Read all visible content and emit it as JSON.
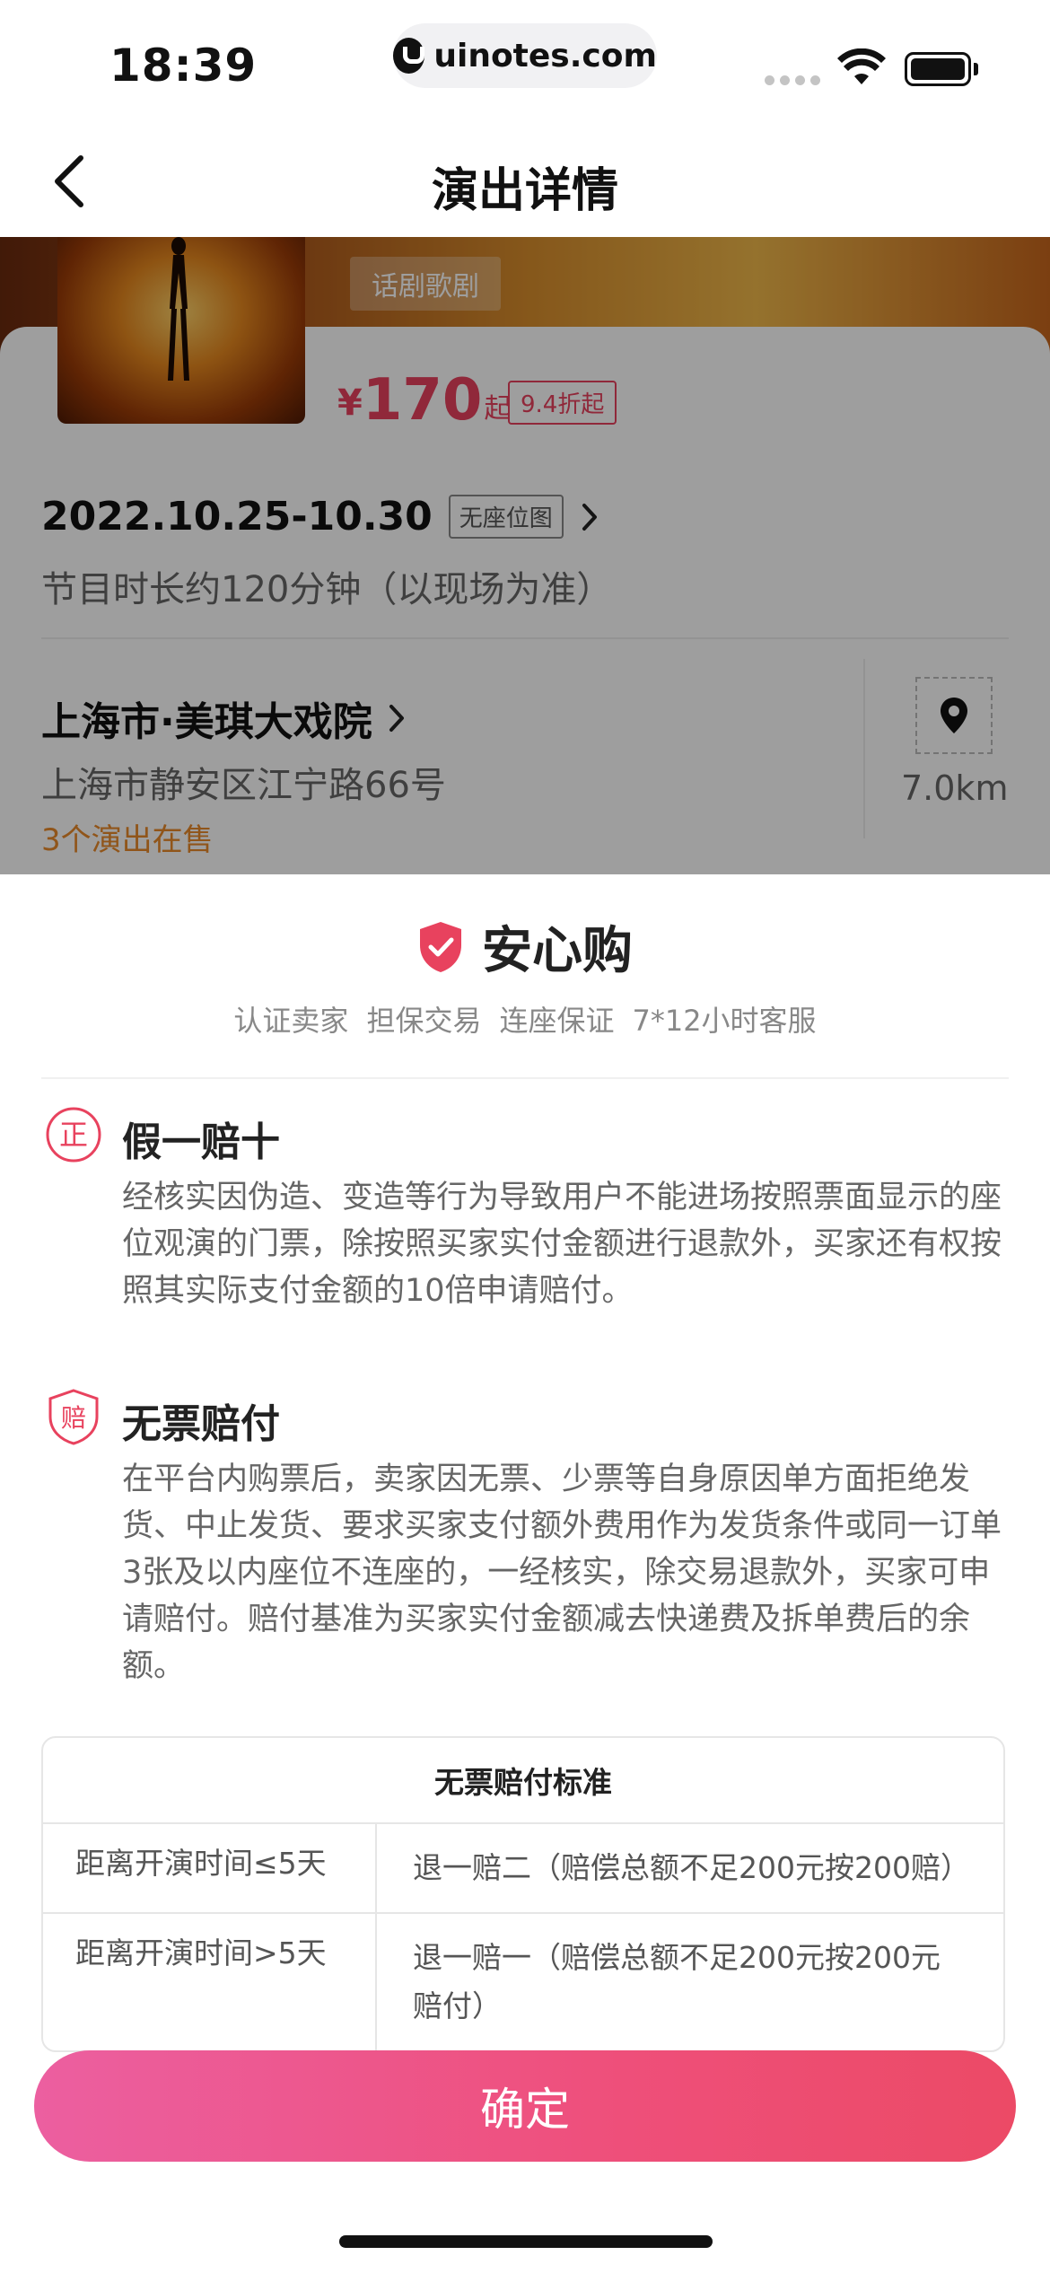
{
  "status_bar": {
    "time": "18:39",
    "url": "uinotes.com"
  },
  "nav": {
    "title": "演出详情",
    "back_icon": "chevron-left-icon"
  },
  "show": {
    "category": "话剧歌剧",
    "price_currency": "¥",
    "price": "170",
    "price_unit": "起",
    "discount": "9.4折起",
    "date_range": "2022.10.25-10.30",
    "seat_map_tag": "无座位图",
    "duration": "节目时长约120分钟（以现场为准）",
    "venue_name": "上海市·美琪大戏院",
    "venue_address": "上海市静安区江宁路66号",
    "shows_on_sale": "3个演出在售",
    "distance": "7.0km"
  },
  "sheet": {
    "title": "安心购",
    "subtitles": [
      "认证卖家",
      "担保交易",
      "连座保证",
      "7*12小时客服"
    ],
    "features": [
      {
        "icon": "zheng-badge-icon",
        "icon_char": "正",
        "title": "假一赔十",
        "desc": "经核实因伪造、变造等行为导致用户不能进场按照票面显示的座位观演的门票，除按照买家实付金额进行退款外，买家还有权按照其实际支付金额的10倍申请赔付。"
      },
      {
        "icon": "pei-shield-icon",
        "icon_char": "赔",
        "title": "无票赔付",
        "desc": "在平台内购票后，卖家因无票、少票等自身原因单方面拒绝发货、中止发货、要求买家支付额外费用作为发货条件或同一订单3张及以内座位不连座的，一经核实，除交易退款外，买家可申请赔付。赔付基准为买家实付金额减去快递费及拆单费后的余额。"
      }
    ],
    "table": {
      "title": "无票赔付标准",
      "rows": [
        {
          "condition": "距离开演时间≤5天",
          "compensation": "退一赔二（赔偿总额不足200元按200赔）"
        },
        {
          "condition": "距离开演时间>5天",
          "compensation": "退一赔一（赔偿总额不足200元按200元赔付）"
        }
      ]
    },
    "confirm_label": "确定"
  },
  "colors": {
    "accent": "#e8425e",
    "orange": "#e98a2a",
    "button_start": "#ec5fa0",
    "button_end": "#ec4a66"
  }
}
